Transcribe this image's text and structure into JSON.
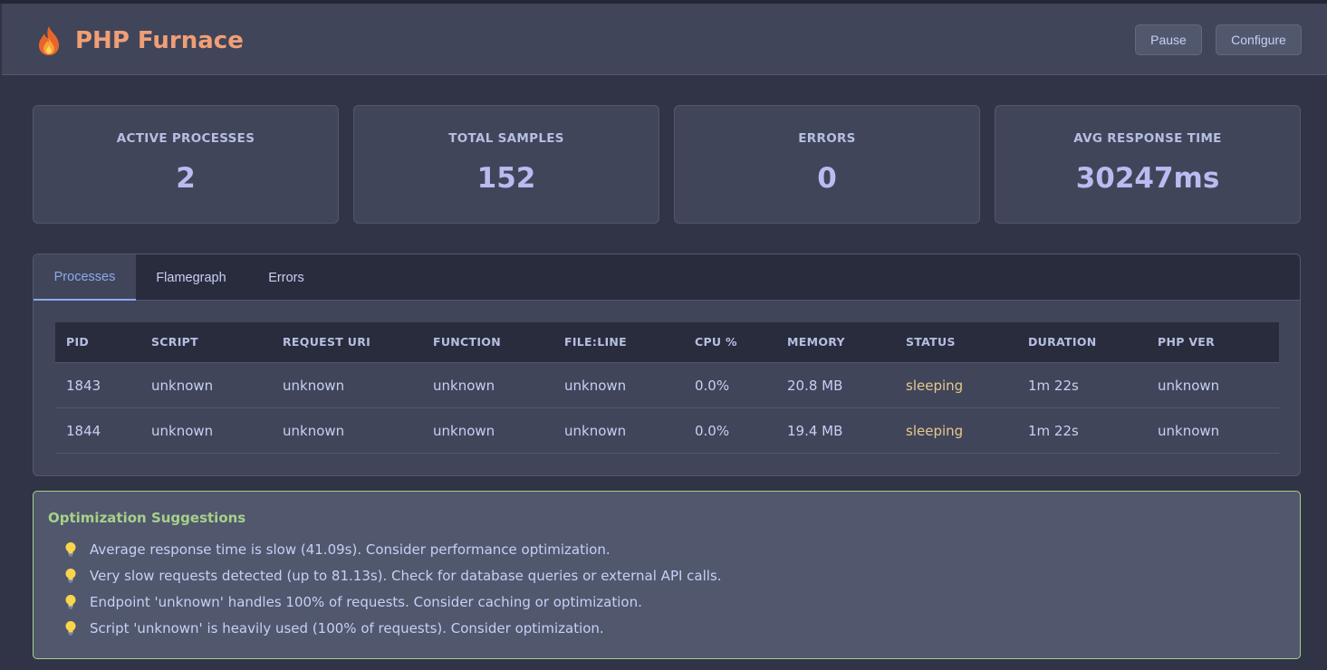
{
  "header": {
    "title": "PHP Furnace",
    "logo_icon": "flame-icon",
    "pause_label": "Pause",
    "configure_label": "Configure"
  },
  "stats": [
    {
      "label": "ACTIVE PROCESSES",
      "value": "2"
    },
    {
      "label": "TOTAL SAMPLES",
      "value": "152"
    },
    {
      "label": "ERRORS",
      "value": "0"
    },
    {
      "label": "AVG RESPONSE TIME",
      "value": "30247ms"
    }
  ],
  "tabs": [
    {
      "label": "Processes",
      "active": true
    },
    {
      "label": "Flamegraph",
      "active": false
    },
    {
      "label": "Errors",
      "active": false
    }
  ],
  "table": {
    "columns": [
      "PID",
      "SCRIPT",
      "REQUEST URI",
      "FUNCTION",
      "FILE:LINE",
      "CPU %",
      "MEMORY",
      "STATUS",
      "DURATION",
      "PHP VER"
    ],
    "rows": [
      [
        "1843",
        "unknown",
        "unknown",
        "unknown",
        "unknown",
        "0.0%",
        "20.8 MB",
        "sleeping",
        "1m 22s",
        "unknown"
      ],
      [
        "1844",
        "unknown",
        "unknown",
        "unknown",
        "unknown",
        "0.0%",
        "19.4 MB",
        "sleeping",
        "1m 22s",
        "unknown"
      ]
    ]
  },
  "suggestions": {
    "title": "Optimization Suggestions",
    "icon": "lightbulb-icon",
    "items": [
      "Average response time is slow (41.09s). Consider performance optimization.",
      "Very slow requests detected (up to 81.13s). Check for database queries or external API calls.",
      "Endpoint 'unknown' handles 100% of requests. Consider caching or optimization.",
      "Script 'unknown' is heavily used (100% of requests). Consider optimization."
    ]
  },
  "colors": {
    "accent": "#8caaee",
    "brand": "#ef9f76",
    "status_sleeping": "#e5c890",
    "suggestion_border": "#a6d189"
  }
}
